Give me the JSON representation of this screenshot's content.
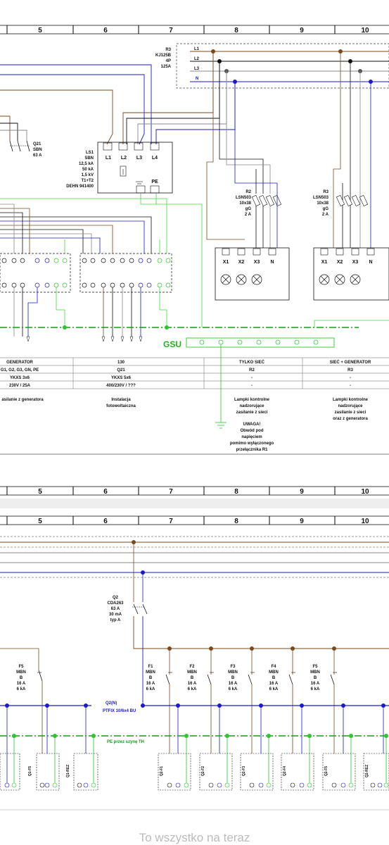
{
  "top_sheet": {
    "columns": [
      "5",
      "6",
      "7",
      "8",
      "9",
      "10"
    ],
    "main_switch": {
      "label": "R3",
      "model": "KJ125B",
      "poles": "4P",
      "current": "125A"
    },
    "bus_labels": [
      "L1",
      "L2",
      "L3",
      "N"
    ],
    "q21": {
      "label": "Q21",
      "model": "SBN",
      "current": "63 A"
    },
    "spd": {
      "label": "LS1",
      "model": "SBN",
      "kA1": "12,5 kA",
      "kA2": "50 kA",
      "kv": "1,5 kV",
      "type": "T1+T2",
      "maker": "DEHN 941400",
      "terminals": [
        "L1",
        "L2",
        "L3",
        "L4"
      ],
      "pe": "PE"
    },
    "r2": {
      "label": "R2",
      "model": "LSN503",
      "size": "10x38",
      "cls": "gG",
      "current": "2 A",
      "terminals": [
        "X1",
        "X2",
        "X3",
        "N"
      ]
    },
    "r3": {
      "label": "R3",
      "model": "LSN503",
      "size": "10x38",
      "cls": "gG",
      "current": "2 A",
      "terminals": [
        "X1",
        "X2",
        "X3",
        "N"
      ]
    },
    "gsu": "GSU",
    "table": {
      "row1": [
        "GENERATOR",
        "130",
        "TYLKO SIEĆ",
        "SIEĆ + GENERATOR"
      ],
      "row2": [
        "G1, G2, G3, GN, PE",
        "Q21",
        "R2",
        "R3"
      ],
      "row3": [
        "YKXS 3x6",
        "YKXS 5x6",
        "-",
        "-"
      ],
      "row4": [
        "230V / 25A",
        "400/230V / ???",
        "-",
        "-"
      ]
    },
    "desc_gen": "asilanie z generatora",
    "desc_pv": [
      "Instalacja",
      "fotowoltaiczna"
    ],
    "desc_r2": [
      "Lampki kontrolne",
      "nadzorujące",
      "zasilanie z sieci"
    ],
    "warning": [
      "UWAGA!",
      "Obwód pod",
      "napięciem",
      "pomimo wyłączonego",
      "przełącznika R1"
    ],
    "desc_r3": [
      "Lampki kontrolne",
      "nadzorujące",
      "zasilanie z sieci",
      "oraz z generatora"
    ]
  },
  "bottom_sheet": {
    "columns": [
      "5",
      "6",
      "7",
      "8",
      "9",
      "10"
    ],
    "q2": {
      "label": "Q2",
      "model": "CDA263",
      "current": "63 A",
      "idn": "30 mA",
      "type": "typ A"
    },
    "breakers": [
      {
        "name": "F5",
        "model": "MBN",
        "char": "B",
        "current": "16 A",
        "ka": "6 kA"
      },
      {
        "name": "F1",
        "model": "MBN",
        "char": "B",
        "current": "16 A",
        "ka": "6 kA"
      },
      {
        "name": "F2",
        "model": "MBN",
        "char": "B",
        "current": "16 A",
        "ka": "6 kA"
      },
      {
        "name": "F3",
        "model": "MBN",
        "char": "B",
        "current": "16 A",
        "ka": "6 kA"
      },
      {
        "name": "F4",
        "model": "MBN",
        "char": "B",
        "current": "16 A",
        "ka": "6 kA"
      },
      {
        "name": "F5",
        "model": "MBN",
        "char": "B",
        "current": "16 A",
        "ka": "6 kA"
      }
    ],
    "n_bus": "Q2(N)",
    "n_bus_part": "PTFIX 10/6x4 BU",
    "pe_bus": "PE przez szynę TH",
    "term_labels": [
      "Q1-F5",
      "Q1-REZ",
      "Q2-F1",
      "Q2-F2",
      "Q2-F3",
      "Q2-F4",
      "Q2-F5",
      "Q2-REZ"
    ]
  },
  "footer": "To wszystko na teraz"
}
